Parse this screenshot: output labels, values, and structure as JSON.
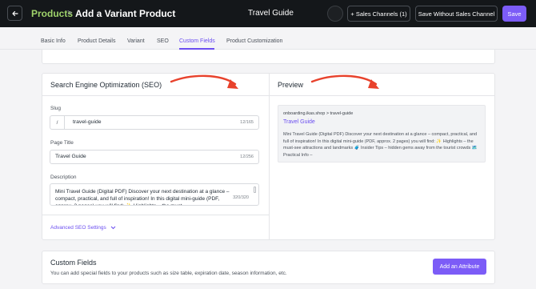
{
  "header": {
    "breadcrumb_root": "Products",
    "breadcrumb_sep": ">",
    "page_title": "Add a Variant Product",
    "product_name": "Travel Guide",
    "sales_channels_label": "+ Sales Channels (1)",
    "save_without_channel_label": "Save Without Sales Channel",
    "save_label": "Save"
  },
  "tabs": [
    {
      "label": "Basic Info"
    },
    {
      "label": "Product Details"
    },
    {
      "label": "Variant"
    },
    {
      "label": "SEO"
    },
    {
      "label": "Custom Fields",
      "active": true
    },
    {
      "label": "Product Customization"
    }
  ],
  "seo": {
    "title": "Search Engine Optimization (SEO)",
    "slug": {
      "label": "Slug",
      "prefix": "/",
      "value": "travel-guide",
      "count": "12/165"
    },
    "page_title": {
      "label": "Page Title",
      "value": "Travel Guide",
      "count": "12/256"
    },
    "description": {
      "label": "Description",
      "value": "Mini Travel Guide (Digital PDF) Discover your next destination at a glance – compact, practical, and full of inspiration! In this digital mini-guide (PDF, approx. 2 pages) you will find: ✨ Highlights – the must-",
      "count": "320/320"
    },
    "advanced_label": "Advanced SEO Settings"
  },
  "preview": {
    "title": "Preview",
    "url": "onboarding.ikas.shop > travel-guide",
    "link_title": "Travel Guide",
    "description": "Mini Travel Guide (Digital PDF) Discover your next destination at a glance – compact, practical, and full of inspiration! In this digital mini-guide (PDF, approx. 2 pages) you will find: ✨ Highlights – the must-see attractions and landmarks 🧳 Insider Tips – hidden gems away from the tourist crowds 🗺️ Practical Info –"
  },
  "custom_fields": {
    "title": "Custom Fields",
    "subtitle": "You can add special fields to your products such as size table, expiration date, season information, etc.",
    "add_label": "Add an Attribute"
  },
  "colors": {
    "accent": "#7c5cf7",
    "breadcrumb": "#9fd36b",
    "arrow": "#e8422c"
  },
  "icons": {
    "back": "arrow-left-icon",
    "advanced_toggle": "chevron-down-icon"
  }
}
